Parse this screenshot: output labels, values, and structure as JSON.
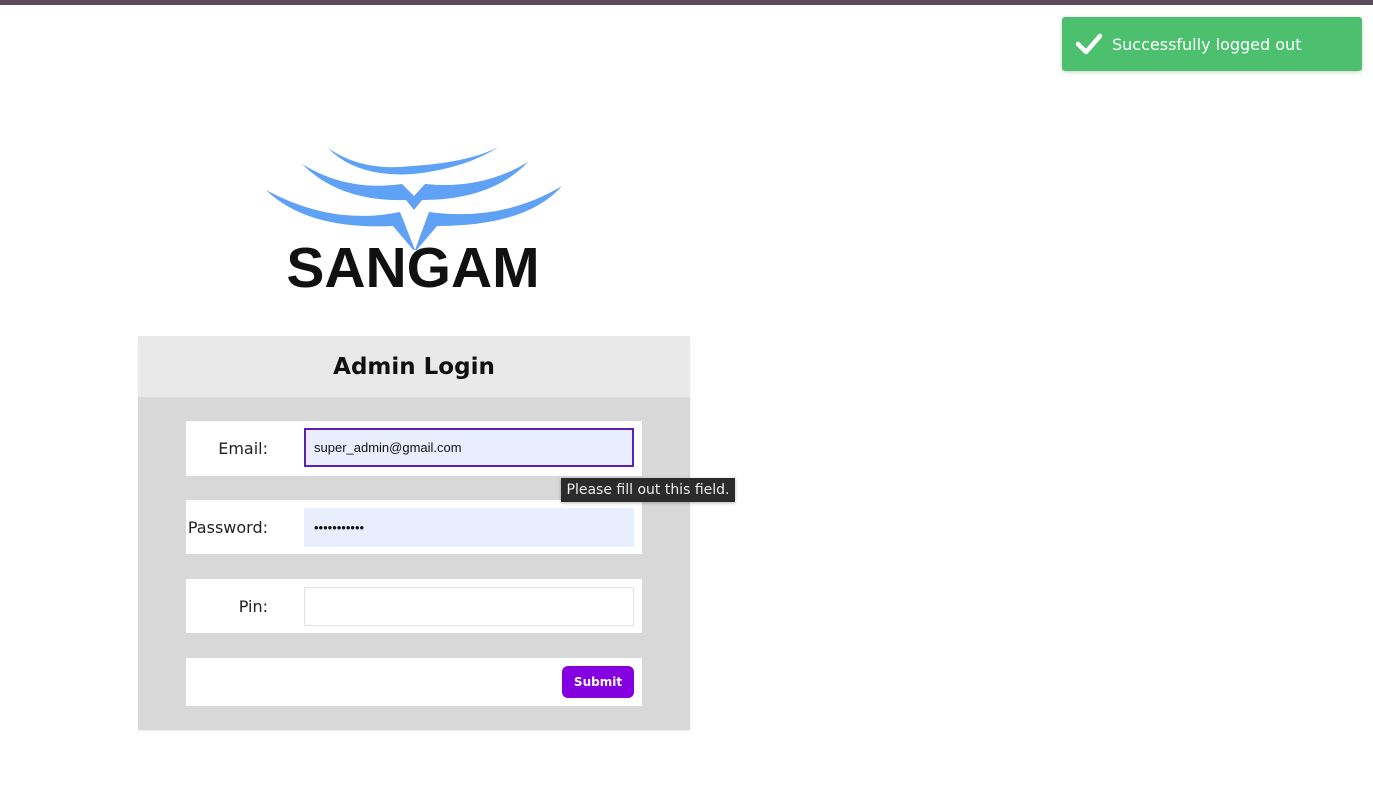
{
  "toast": {
    "icon": "check-icon",
    "message": "Successfully logged out",
    "color": "#4cc06f"
  },
  "logo": {
    "text": "SANGAM",
    "wave_color": "#5ea1f5"
  },
  "login": {
    "title": "Admin Login",
    "email_label": "Email:",
    "email_value": "super_admin@gmail.com",
    "password_label": "Password:",
    "password_value": "•••••••••••",
    "pin_label": "Pin:",
    "pin_value": "",
    "submit_label": "Submit",
    "accent": "#8400e0"
  },
  "tooltip": {
    "text": "Please fill out this field."
  }
}
